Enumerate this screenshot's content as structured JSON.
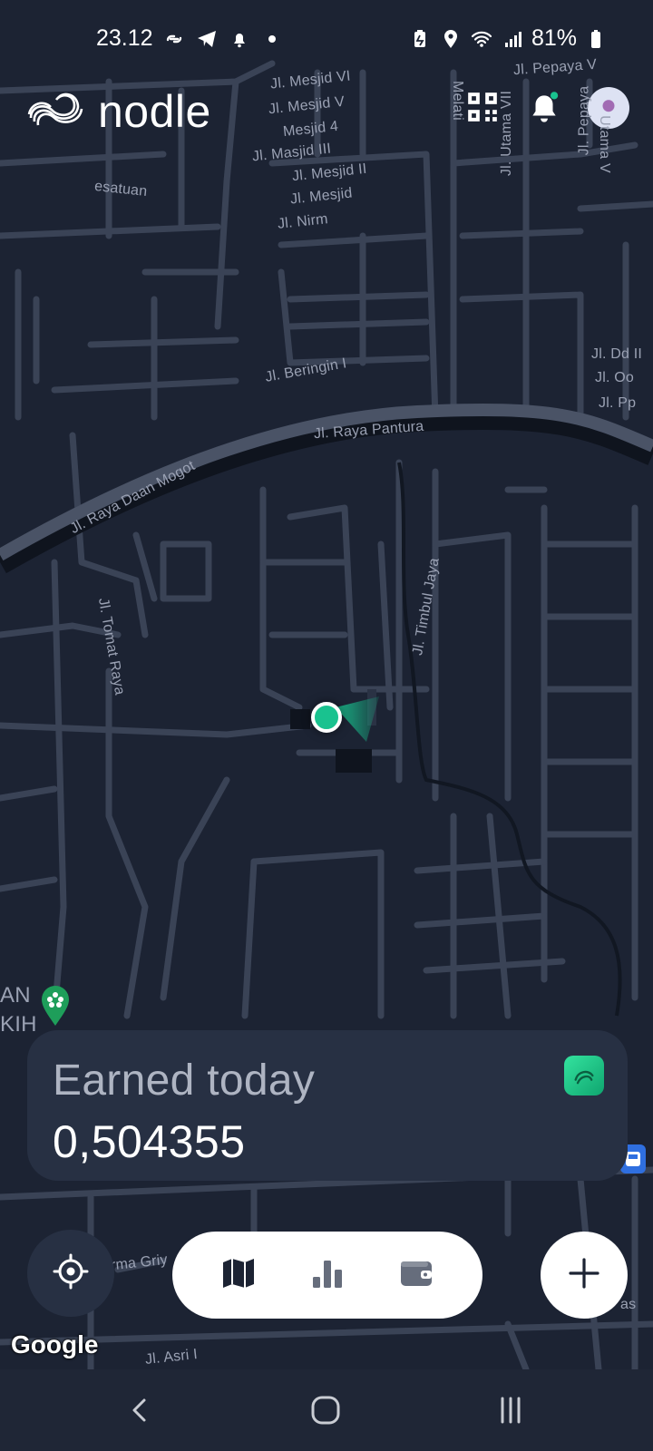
{
  "status_bar": {
    "time": "23.12",
    "battery": "81%",
    "left_icons": [
      "link-icon",
      "telegram-icon",
      "notification-bell-icon",
      "dot-icon"
    ],
    "right_icons": [
      "battery-saver-icon",
      "location-icon",
      "wifi-icon",
      "signal-icon",
      "battery-icon"
    ]
  },
  "header": {
    "brand_name": "nodle",
    "icons": [
      "qr-code-icon",
      "bell-icon",
      "avatar"
    ],
    "notification_dot_color": "#19c28f"
  },
  "map": {
    "labels": {
      "l1": "Jl. Mesjid VI",
      "l2": "Jl. Mesjid V",
      "l3": "Mesjid 4",
      "l4": "Jl. Masjid III",
      "l5": "Jl. Mesjid II",
      "l6": "Jl. Mesjid",
      "l7": "Jl. Nirm",
      "l8": "esatuan",
      "l9": "Jl. Pepaya V",
      "l10": "Melati",
      "l11": "Jl. Utama VII",
      "l12": "Jl. Pepaya",
      "l13": "Utama V",
      "l14": "Jl. Beringin I",
      "l15": "Jl. Dd II",
      "l16": "Jl. Oo",
      "l17": "Jl. Pp",
      "l18": "Jl. Raya Pantura",
      "l19": "Jl. Raya Daan Mogot",
      "l20": "Jl. Timbul Jaya",
      "l21": "Jl. Tomat Raya",
      "l22": "AN",
      "l23": "KIH",
      "l24": "rma Griy",
      "l25": "Jl. Asri I",
      "l26": "as"
    },
    "accent_color": "#19c28f",
    "attribution": "Google"
  },
  "earned": {
    "label": "Earned today",
    "value": "0,504355"
  },
  "bottom_nav": {
    "items": [
      "map-icon",
      "bar-chart-icon",
      "wallet-icon"
    ],
    "locate_icon": "crosshair-icon",
    "add_icon": "plus-icon"
  },
  "system_nav": {
    "items": [
      "back-icon",
      "home-icon",
      "recents-icon"
    ]
  }
}
